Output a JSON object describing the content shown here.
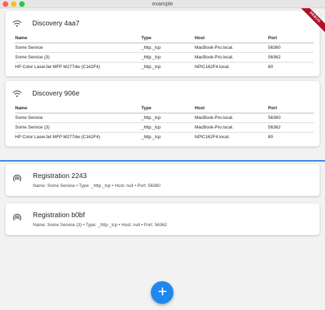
{
  "window": {
    "title": "example"
  },
  "debug_banner": "DEBUG",
  "table_headers": {
    "name": "Name",
    "type": "Type",
    "host": "Host",
    "port": "Port"
  },
  "discoveries": [
    {
      "title": "Discovery 4aa7",
      "rows": [
        {
          "name": "Some Service",
          "type": "_http._tcp",
          "host": "MacBook-Pro.local.",
          "port": "56360"
        },
        {
          "name": "Some Service (3)",
          "type": "_http._tcp",
          "host": "MacBook-Pro.local.",
          "port": "56362"
        },
        {
          "name": "HP Color LaserJet MFP M277dw (C162F4)",
          "type": "_http._tcp",
          "host": "NPIC162F4.local.",
          "port": "80"
        }
      ]
    },
    {
      "title": "Discovery 906e",
      "rows": [
        {
          "name": "Some Service",
          "type": "_http._tcp",
          "host": "MacBook-Pro.local.",
          "port": "56360"
        },
        {
          "name": "Some Service (3)",
          "type": "_http._tcp",
          "host": "MacBook-Pro.local.",
          "port": "56362"
        },
        {
          "name": "HP Color LaserJet MFP M277dw (C162F4)",
          "type": "_http._tcp",
          "host": "NPIC162F4.local.",
          "port": "80"
        }
      ]
    }
  ],
  "registrations": [
    {
      "title": "Registration 2243",
      "subtitle": "Name: Some Service • Type: _http._tcp • Host: null • Port: 56360"
    },
    {
      "title": "Registration b0bf",
      "subtitle": "Name: Some Service (3) • Type: _http._tcp • Host: null • Port: 56362"
    }
  ],
  "fab": {
    "icon": "plus-icon",
    "color": "#1f88ee"
  },
  "colors": {
    "divider": "#2b7de9",
    "debug_banner": "#b0102a"
  }
}
